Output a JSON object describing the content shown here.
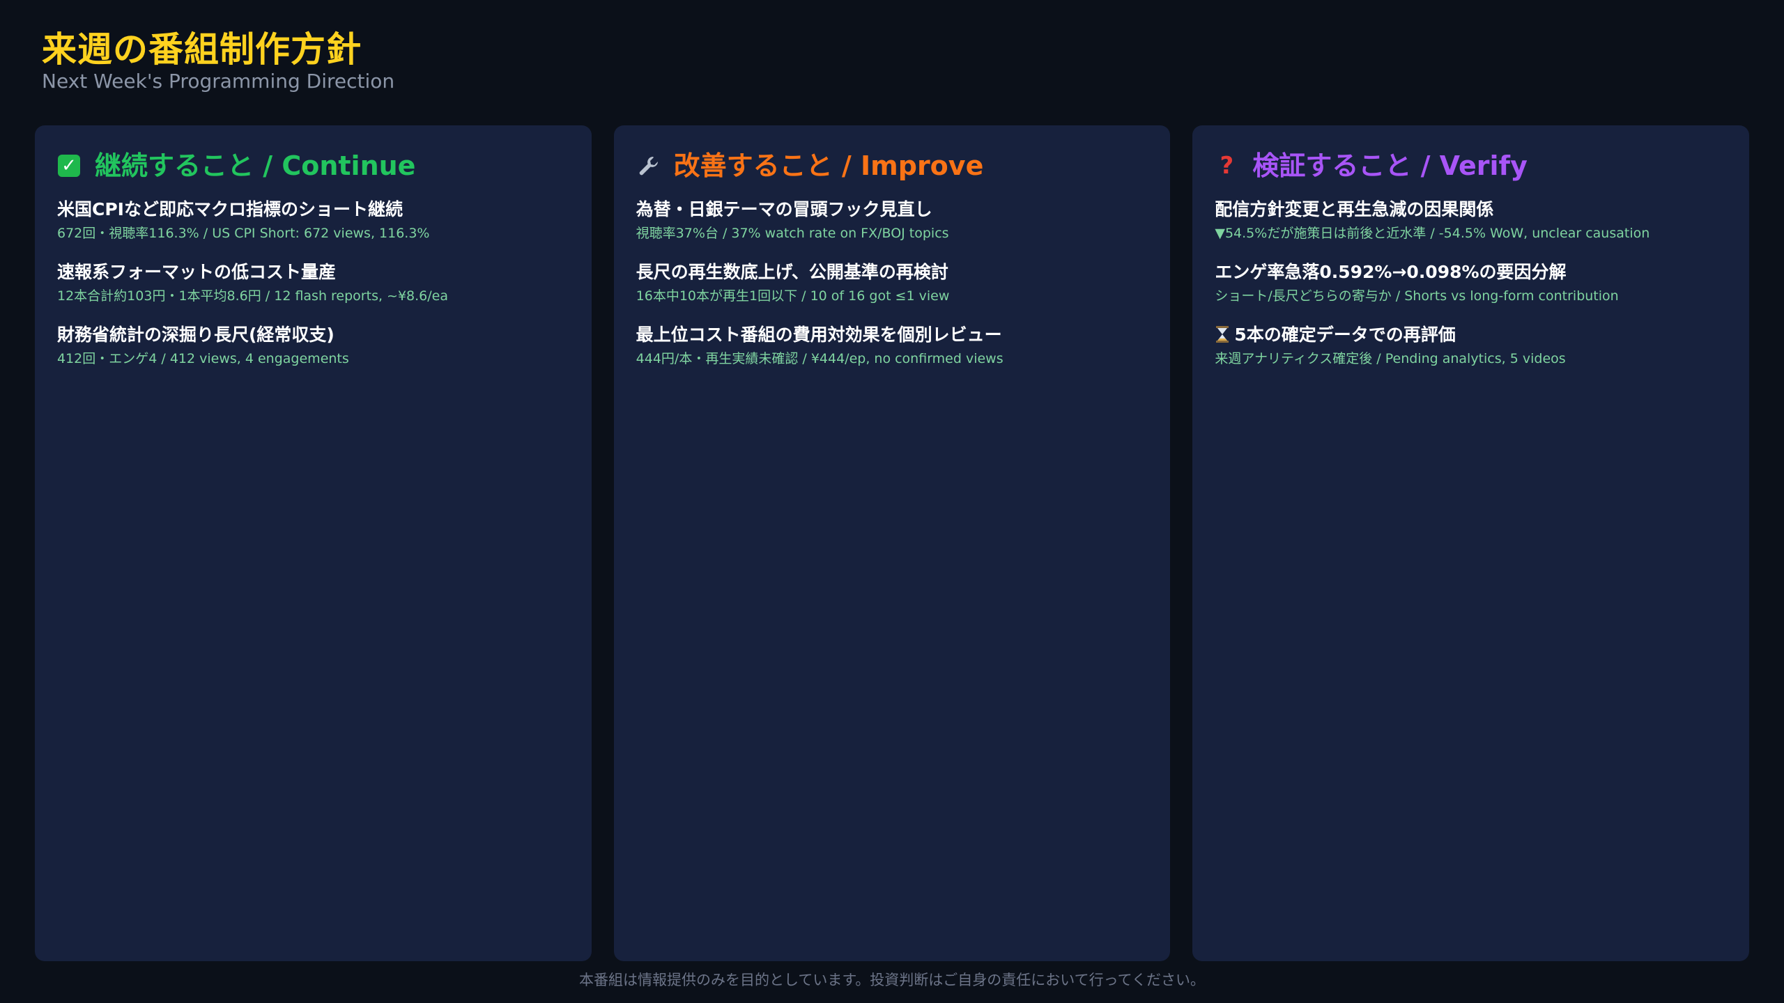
{
  "header": {
    "title": "来週の番組制作方針",
    "subtitle": "Next Week's Programming Direction"
  },
  "columns": [
    {
      "heading": "継続すること / Continue",
      "icon": "check-icon",
      "color": "#22c55e",
      "items": [
        {
          "title": "米国CPIなど即応マクロ指標のショート継続",
          "detail": "672回・視聴率116.3% / US CPI Short: 672 views, 116.3%"
        },
        {
          "title": "速報系フォーマットの低コスト量産",
          "detail": "12本合計約103円・1本平均8.6円 / 12 flash reports, ~¥8.6/ea"
        },
        {
          "title": "財務省統計の深掘り長尺(経常収支)",
          "detail": "412回・エンゲ4 / 412 views, 4 engagements"
        }
      ]
    },
    {
      "heading": "改善すること / Improve",
      "icon": "wrench-icon",
      "color": "#f97316",
      "items": [
        {
          "title": "為替・日銀テーマの冒頭フック見直し",
          "detail": "視聴率37%台 / 37% watch rate on FX/BOJ topics"
        },
        {
          "title": "長尺の再生数底上げ、公開基準の再検討",
          "detail": "16本中10本が再生1回以下 / 10 of 16 got ≤1 view"
        },
        {
          "title": "最上位コスト番組の費用対効果を個別レビュー",
          "detail": "444円/本・再生実績未確認 / ¥444/ep, no confirmed views"
        }
      ]
    },
    {
      "heading": "検証すること / Verify",
      "icon": "question-icon",
      "color": "#a855f7",
      "items": [
        {
          "title": "配信方針変更と再生急減の因果関係",
          "detail": "▼54.5%だが施策日は前後と近水準 / -54.5% WoW, unclear causation"
        },
        {
          "title": "エンゲ率急落0.592%→0.098%の要因分解",
          "detail": "ショート/長尺どちらの寄与か / Shorts vs long-form contribution"
        },
        {
          "title": "5本の確定データでの再評価",
          "detail": "来週アナリティクス確定後 / Pending analytics, 5 videos",
          "lead_icon": "hourglass-icon"
        }
      ]
    }
  ],
  "footer": {
    "disclaimer": "本番組は情報提供のみを目的としています。投資判断はご自身の責任において行ってください。"
  }
}
